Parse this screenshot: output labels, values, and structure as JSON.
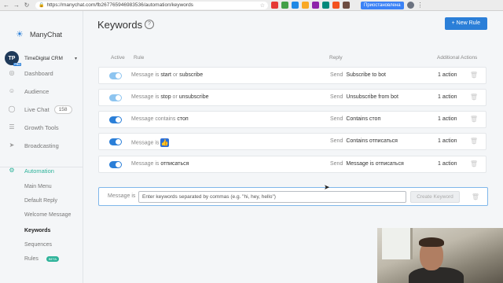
{
  "browser": {
    "url": "https://manychat.com/fb267765946983536/automation/keywords",
    "paused_label": "Приостановлена",
    "extension_colors": [
      "#e53935",
      "#43a047",
      "#1e88e5",
      "#f9a825",
      "#8e24aa",
      "#00897b",
      "#f4511e",
      "#6d4c41"
    ]
  },
  "brand": {
    "name": "ManyChat",
    "accent": "#2b7fd8",
    "active_color": "#2eb39a"
  },
  "account": {
    "initials": "TP",
    "badge": "PRO",
    "name": "TimeDigital CRM"
  },
  "sidebar": {
    "items": [
      {
        "label": "Dashboard",
        "icon": "dashboard-icon"
      },
      {
        "label": "Audience",
        "icon": "user-icon"
      },
      {
        "label": "Live Chat",
        "icon": "chat-icon",
        "count": "158"
      },
      {
        "label": "Growth Tools",
        "icon": "growth-icon"
      },
      {
        "label": "Broadcasting",
        "icon": "broadcast-icon"
      }
    ],
    "automation": {
      "label": "Automation",
      "icon": "automation-icon",
      "subitems": [
        "Main Menu",
        "Default Reply",
        "Welcome Message",
        "Keywords",
        "Sequences",
        "Rules"
      ],
      "current": "Keywords",
      "rules_badge": "BETA"
    }
  },
  "page": {
    "title": "Keywords",
    "new_rule_label": "+ New Rule"
  },
  "table": {
    "headers": {
      "active": "Active",
      "rule": "Rule",
      "reply": "Reply",
      "actions": "Additional Actions"
    },
    "rows": [
      {
        "active": true,
        "condition": "Message is",
        "keywords": [
          "start",
          "subscribe"
        ],
        "reply_prefix": "Send",
        "reply": "Subscribe to bot",
        "actions": "1 action"
      },
      {
        "active": true,
        "condition": "Message is",
        "keywords": [
          "stop",
          "unsubscribe"
        ],
        "reply_prefix": "Send",
        "reply": "Unsubscribe from bot",
        "actions": "1 action"
      },
      {
        "active": true,
        "condition": "Message contains",
        "keywords": [
          "стоп"
        ],
        "reply_prefix": "Send",
        "reply": "Contains стоп",
        "actions": "1 action"
      },
      {
        "active": true,
        "condition": "Message is",
        "keywords": [
          "thumbs-up-icon"
        ],
        "reply_prefix": "Send",
        "reply": "Contains отписаться",
        "actions": "1 action"
      },
      {
        "active": true,
        "condition": "Message is",
        "keywords": [
          "отписаться"
        ],
        "reply_prefix": "Send",
        "reply": "Message is отписаться",
        "actions": "1 action"
      }
    ],
    "or_word": "or",
    "new_rule": {
      "condition": "Message is",
      "placeholder": "Enter keywords separated by commas (e.g. \"hi, hey, hello\")",
      "create_label": "Create Keyword"
    }
  }
}
